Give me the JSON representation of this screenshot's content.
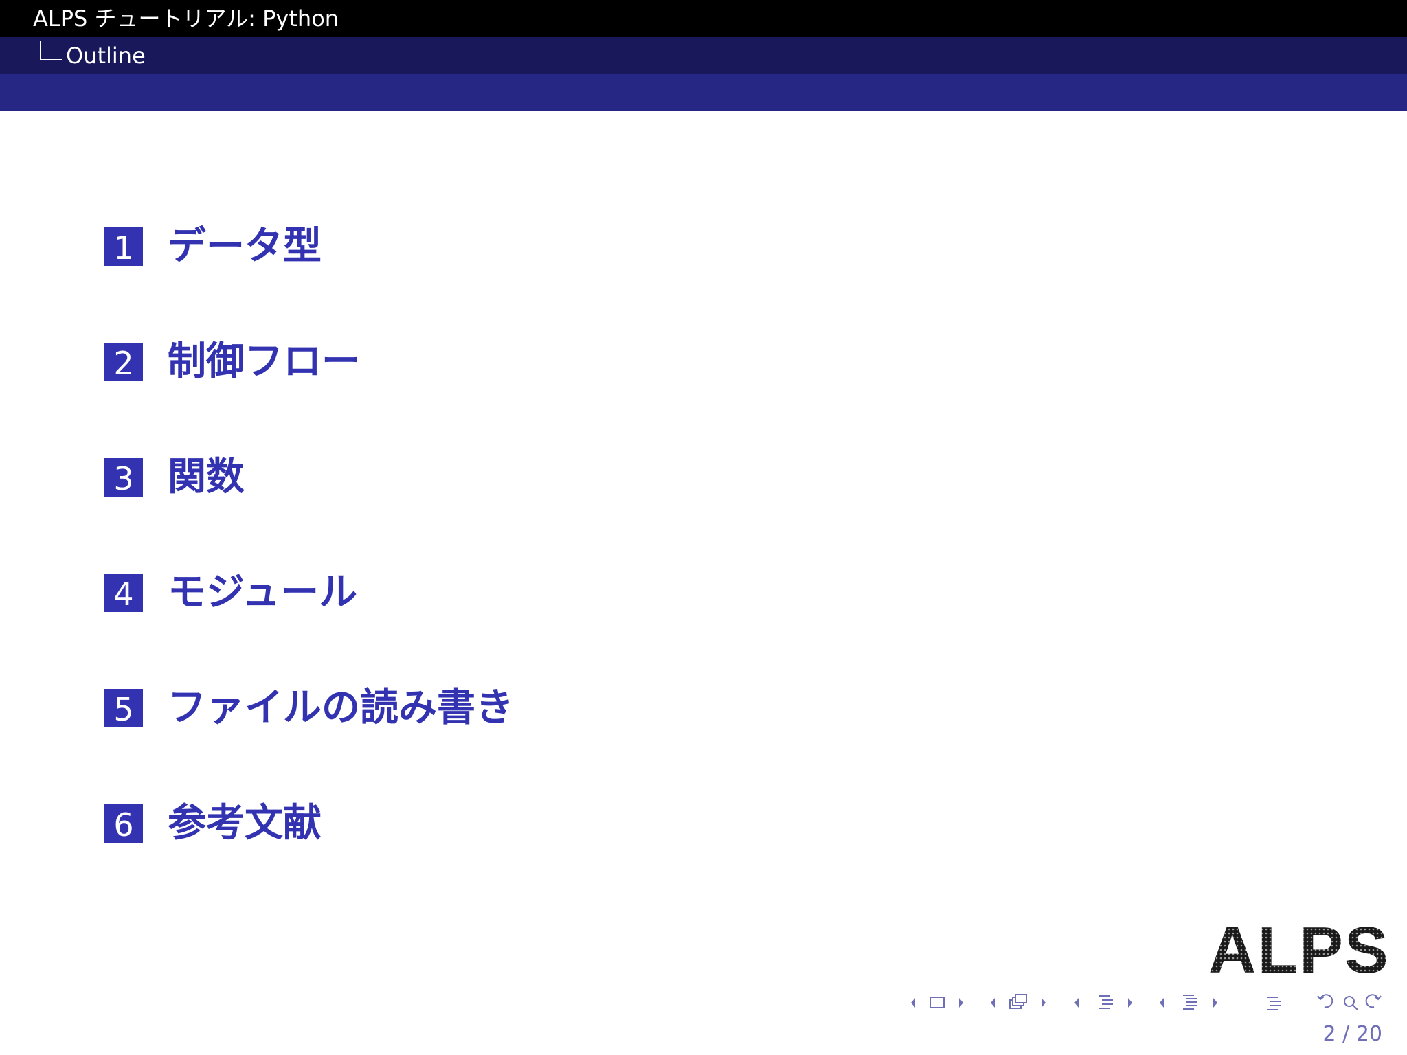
{
  "header": {
    "title": "ALPS チュートリアル: Python",
    "section": "Outline"
  },
  "toc": {
    "items": [
      {
        "number": "1",
        "label": "データ型"
      },
      {
        "number": "2",
        "label": "制御フロー"
      },
      {
        "number": "3",
        "label": "関数"
      },
      {
        "number": "4",
        "label": "モジュール"
      },
      {
        "number": "5",
        "label": "ファイルの読み書き"
      },
      {
        "number": "6",
        "label": "参考文献"
      }
    ]
  },
  "logo": {
    "text": "ALPS"
  },
  "navigation": {
    "icons": [
      "nav-left-arrow-icon",
      "frame-icon",
      "nav-right-arrow-icon",
      "nav-left-arrow-icon",
      "subsection-icon",
      "nav-right-arrow-icon",
      "nav-left-arrow-icon",
      "section-icon",
      "nav-right-arrow-icon",
      "nav-left-arrow-icon",
      "document-icon",
      "nav-right-arrow-icon",
      "appendix-icon",
      "back-icon",
      "search-icon",
      "forward-icon"
    ],
    "page_current": "2",
    "page_total": "20",
    "page_label": "2 / 20"
  },
  "colors": {
    "title_bar": "#000000",
    "subtitle_bar": "#18185a",
    "band": "#262684",
    "accent": "#3333b2",
    "nav": "#6f6fb8"
  }
}
